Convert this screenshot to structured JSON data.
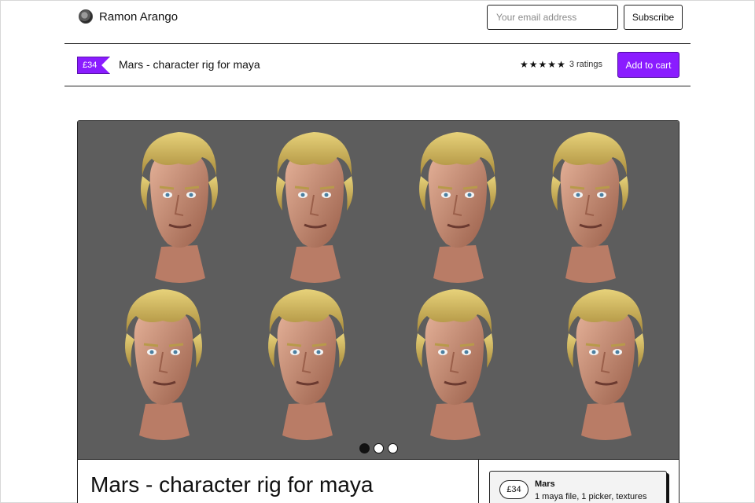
{
  "header": {
    "creator_name": "Ramon Arango",
    "email_placeholder": "Your email address",
    "subscribe_label": "Subscribe"
  },
  "product_bar": {
    "price": "£34",
    "title": "Mars - character rig for maya",
    "rating_stars": 5,
    "rating_text": "3 ratings",
    "cart_label": "Add to cart"
  },
  "gallery": {
    "slide_count": 3,
    "active_slide": 1,
    "background": "#5d5d5d",
    "description": "8 head renders of a blond cartoon male character with various expressions"
  },
  "product": {
    "title": "Mars - character rig for maya"
  },
  "option": {
    "price": "£34",
    "name": "Mars",
    "description": "1 maya file, 1 picker, textures"
  },
  "colors": {
    "accent": "#8a1cff",
    "border": "#222222"
  }
}
